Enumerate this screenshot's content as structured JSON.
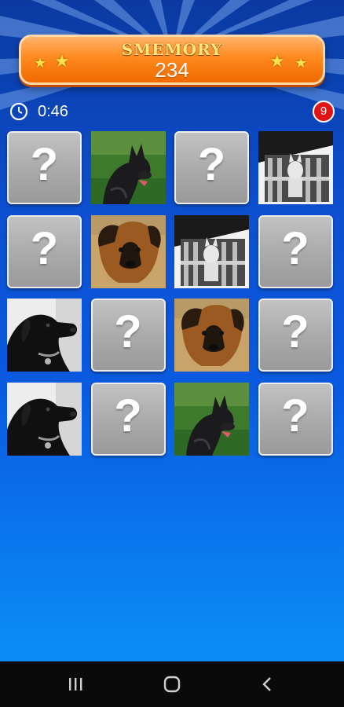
{
  "game": {
    "title": "SMEMORY",
    "score": "234",
    "timer": "0:46",
    "moves_badge": "9"
  },
  "colors": {
    "banner_orange": "#ff8a1e",
    "title_gold": "#ffe680",
    "badge_red": "#e01414",
    "background_blue": "#0d4fd0"
  },
  "cards": [
    {
      "state": "hidden"
    },
    {
      "state": "revealed",
      "image": "black-shepherd-dog"
    },
    {
      "state": "hidden"
    },
    {
      "state": "revealed",
      "image": "husky-on-balcony"
    },
    {
      "state": "hidden"
    },
    {
      "state": "revealed",
      "image": "german-shepherd-puppy"
    },
    {
      "state": "revealed",
      "image": "husky-on-balcony"
    },
    {
      "state": "hidden"
    },
    {
      "state": "revealed",
      "image": "black-labrador"
    },
    {
      "state": "hidden"
    },
    {
      "state": "revealed",
      "image": "german-shepherd-puppy"
    },
    {
      "state": "hidden"
    },
    {
      "state": "revealed",
      "image": "black-labrador"
    },
    {
      "state": "hidden"
    },
    {
      "state": "revealed",
      "image": "black-shepherd-dog"
    },
    {
      "state": "hidden"
    }
  ],
  "hidden_card_symbol": "?",
  "icons": {
    "timer": "clock-icon",
    "nav_recent": "recent-apps-icon",
    "nav_home": "home-icon",
    "nav_back": "back-icon"
  }
}
